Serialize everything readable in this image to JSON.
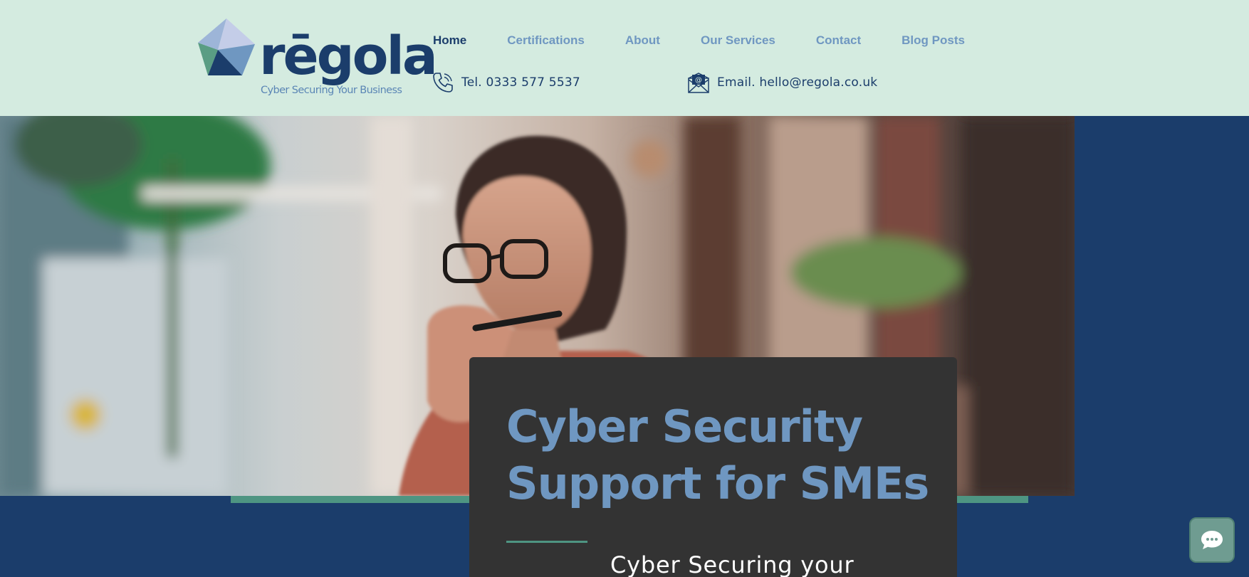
{
  "brand": {
    "name": "rēgola",
    "tagline": "Cyber Securing Your Business",
    "logo_icon": "geometric-gem-icon"
  },
  "nav": {
    "items": [
      {
        "label": "Home",
        "active": true
      },
      {
        "label": "Certifications",
        "active": false
      },
      {
        "label": "About",
        "active": false
      },
      {
        "label": "Our Services",
        "active": false
      },
      {
        "label": "Contact",
        "active": false
      },
      {
        "label": "Blog Posts",
        "active": false
      }
    ]
  },
  "contact": {
    "phone": {
      "icon": "phone-icon",
      "text": "Tel. 0333 577 5537"
    },
    "email": {
      "icon": "envelope-icon",
      "text": "Email. hello@regola.co.uk"
    }
  },
  "hero": {
    "image": "woman-with-glasses-thinking-photo",
    "title_line1": "Cyber Security",
    "title_line2": "Support for SMEs",
    "subtitle": "Cyber Securing your"
  },
  "chat": {
    "icon": "chat-bubble-icon"
  },
  "colors": {
    "header_bg": "#d4ebe0",
    "navy": "#1b3d6b",
    "accent_blue": "#6f97c1",
    "accent_green": "#4e9582",
    "card_bg": "#333333",
    "chat_bg": "#6f9c91"
  }
}
